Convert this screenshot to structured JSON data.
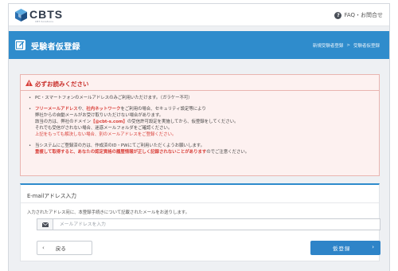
{
  "header": {
    "logo_text": "CBTS",
    "logo_sub": "CBT-Solutions",
    "faq_label": "FAQ・お問合せ"
  },
  "banner": {
    "title": "受験者仮登録",
    "breadcrumb": [
      "新規受験者登録",
      "受験者仮登録"
    ]
  },
  "notice": {
    "title": "必ずお読みください",
    "item1": "PC・スマートフォンのメールアドレスのみご利用いただけます。（ガラケー不可）",
    "item2_part1_red": "フリーメールアドレス",
    "item2_part1_mid": "や、",
    "item2_part1_red2": "社内ネットワーク",
    "item2_part1_end": "をご利用の場合、セキュリティ設定等により",
    "item2_line2": "弊社からの自動メールがお受け取りいただけない場合があります。",
    "item2_line3_start": "該当の方は、弊社のドメイン",
    "item2_domain": "【@cbt-s.com】",
    "item2_line3_end": "の受信許可設定を実施してから、仮登録をしてください。",
    "item2_line4": "それでも受信がされない場合、迷惑メールフォルダをご確認ください。",
    "item2_line5_red": "上記をもっても解決しない場合、別のメールアドレスをご登録ください。",
    "item3_line1": "当システムにご登録済の方は、作成済のID・PWにてご利用いただくようお願いします。",
    "item3_line2_red": "重複して取得すると、あなたの認定資格の履歴情報が正しく記録されないことがあります",
    "item3_line2_end": "のでご注意ください。"
  },
  "form": {
    "title": "E-mailアドレス入力",
    "description": "入力されたアドレス宛に、本登録手続きについて記載されたメールをお送りします。",
    "email_value": "",
    "email_placeholder": "メールアドレスを入力",
    "back_label": "戻る",
    "submit_label": "仮登録"
  },
  "colors": {
    "accent": "#2f8ccc",
    "alert": "#d9403a",
    "alert_bg": "#fdf1f0"
  },
  "icons": {
    "header": "question-circle-icon",
    "banner": "edit-icon",
    "notice": "warning-icon",
    "input_addon": "envelope-icon",
    "back": "chevron-left-icon",
    "submit": "chevron-right-icon"
  }
}
